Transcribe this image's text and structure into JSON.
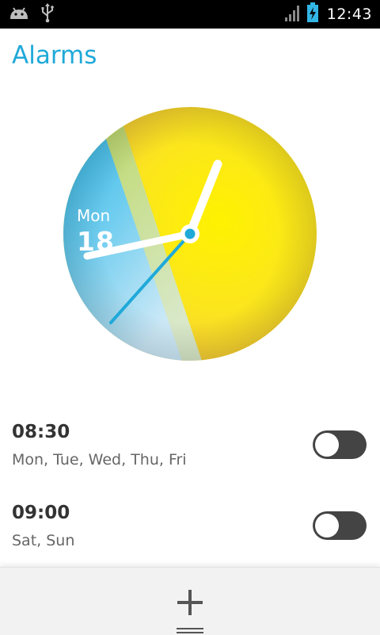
{
  "status_bar": {
    "time": "12:43",
    "left_icons": [
      "android-icon",
      "usb-icon"
    ],
    "right_icons": [
      "signal-icon",
      "battery-charging-icon"
    ],
    "accent": "#33b5e5"
  },
  "header": {
    "title": "Alarms",
    "title_color": "#1fa9d9"
  },
  "clock": {
    "day": "Mon",
    "date": "18",
    "hand_color": "#ffffff",
    "second_hand_color": "#1fa9d9"
  },
  "alarms": [
    {
      "time": "08:30",
      "days": "Mon, Tue, Wed, Thu, Fri",
      "enabled": false
    },
    {
      "time": "09:00",
      "days": "Sat, Sun",
      "enabled": false
    }
  ],
  "bottom_bar": {
    "add_icon": "plus-icon",
    "handle_icon": "drag-handle-icon"
  }
}
